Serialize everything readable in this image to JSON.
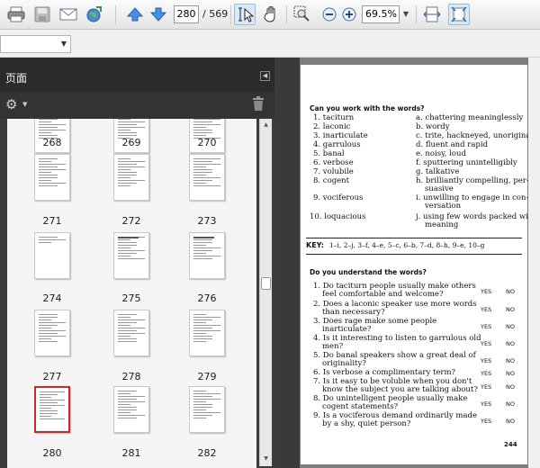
{
  "toolbar": {
    "page_current": "280",
    "page_total": "/ 569",
    "zoom_value": "69.5%",
    "icons": [
      "print-icon",
      "save-icon",
      "email-icon",
      "share-globe-icon",
      "prev-page-icon",
      "next-page-icon",
      "select-tool-icon",
      "hand-tool-icon",
      "marquee-zoom-icon",
      "zoom-out-icon",
      "zoom-in-icon",
      "fit-width-icon",
      "fit-page-icon"
    ]
  },
  "panel": {
    "title": "页面",
    "thumbnails": [
      {
        "label": "268"
      },
      {
        "label": "269"
      },
      {
        "label": "270"
      },
      {
        "label": "271"
      },
      {
        "label": "272"
      },
      {
        "label": "273"
      },
      {
        "label": "274"
      },
      {
        "label": "275"
      },
      {
        "label": "276"
      },
      {
        "label": "277"
      },
      {
        "label": "278"
      },
      {
        "label": "279"
      },
      {
        "label": "280"
      },
      {
        "label": "281"
      },
      {
        "label": "282"
      }
    ],
    "selected": "280"
  },
  "document": {
    "heading1": "Can you work with the words?",
    "words": [
      "1. taciturn",
      "2. laconic",
      "3. inarticulate",
      "4. garrulous",
      "5. banal",
      "6. verbose",
      "7. volubile",
      "8. cogent",
      "9. vociferous",
      "10. loquacious"
    ],
    "definitions": [
      "a. chattering meaninglessly",
      "b. wordy",
      "c. trite, hackneyed, unoriginal",
      "d. fluent and rapid",
      "e. noisy, loud",
      "f. sputtering unintelligibly",
      "g. talkative",
      "h. brilliantly compelling, per-",
      "suasive",
      "i. unwilling to engage in con-",
      "versation",
      "j. using few words packed with",
      "meaning"
    ],
    "key_label": "KEY:",
    "key_text": "1–i, 2–j, 3–f, 4–e, 5–c, 6–b, 7–d, 8–h, 9–e, 10–g",
    "heading2": "Do you understand the words?",
    "questions": [
      {
        "line1": "1. Do taciturn people usually make others",
        "line2": "feel comfortable and welcome?"
      },
      {
        "line1": "2. Does a laconic speaker use more words",
        "line2": "than necessary?"
      },
      {
        "line1": "3. Does rage make some people",
        "line2": "inarticulate?"
      },
      {
        "line1": "4. Is it interesting to listen to garrulous old",
        "line2": "men?"
      },
      {
        "line1": "5. Do banal speakers show a great deal of",
        "line2": "originality?"
      },
      {
        "line1": "6. Is verbose a complimentary term?",
        "line2": ""
      },
      {
        "line1": "7. Is it easy to be voluble when you don't",
        "line2": "know the subject you are talking about?"
      },
      {
        "line1": "8. Do unintelligent people usually make",
        "line2": "cogent statements?"
      },
      {
        "line1": "9. Is a vociferous demand ordinarily made",
        "line2": "by a shy, quiet person?"
      }
    ],
    "yes_label": "YES",
    "no_label": "NO",
    "page_number": "244"
  }
}
